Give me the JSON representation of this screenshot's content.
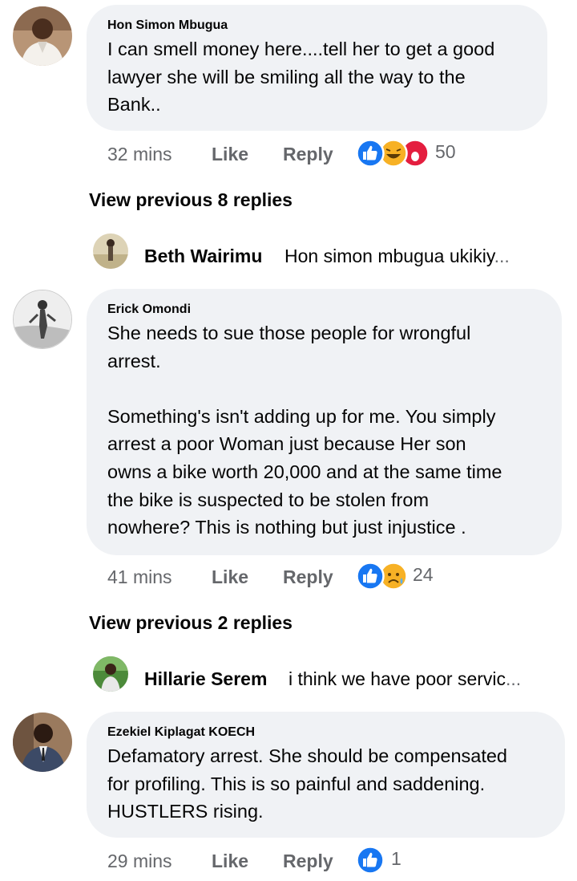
{
  "comments": [
    {
      "author": "Hon Simon Mbugua",
      "lines": [
        "I can smell money here....tell her to get a good",
        "lawyer she will be smiling all the way to the",
        "Bank.."
      ],
      "time": "32 mins",
      "like_label": "Like",
      "reply_label": "Reply",
      "reactions": [
        "like-icon",
        "laugh-icon",
        "wow-icon"
      ],
      "reaction_count": "50"
    },
    {
      "author": "Erick Omondi",
      "lines": [
        "She needs to sue those people for wrongful",
        "arrest.",
        "",
        "Something's isn't adding up for me. You simply",
        "arrest a poor Woman just because Her son",
        "owns a bike worth 20,000 and at the same time",
        "the bike is suspected to be stolen from",
        "nowhere? This is nothing but just injustice ."
      ],
      "time": "41 mins",
      "like_label": "Like",
      "reply_label": "Reply",
      "reactions": [
        "like-icon",
        "sad-icon"
      ],
      "reaction_count": "24"
    },
    {
      "author": "Ezekiel Kiplagat KOECH",
      "lines": [
        "Defamatory arrest. She should be compensated",
        "for profiling. This is so painful and saddening.",
        "HUSTLERS rising."
      ],
      "time": "29 mins",
      "like_label": "Like",
      "reply_label": "Reply",
      "reactions": [
        "like-icon"
      ],
      "reaction_count": "1"
    }
  ],
  "threads": [
    {
      "view_previous": "View previous 8 replies",
      "reply_name": "Beth Wairimu",
      "reply_snippet": "Hon simon mbugua ukikiy",
      "ellipsis": "..."
    },
    {
      "view_previous": "View previous 2 replies",
      "reply_name": "Hillarie Serem",
      "reply_snippet": "i think we have poor servic",
      "ellipsis": "..."
    }
  ],
  "colors": {
    "bubble": "#f0f2f5",
    "meta": "#65676b",
    "like_blue": "#1877f2",
    "haha_yellow": "#f7b125",
    "wow_red": "#e41e3f"
  }
}
